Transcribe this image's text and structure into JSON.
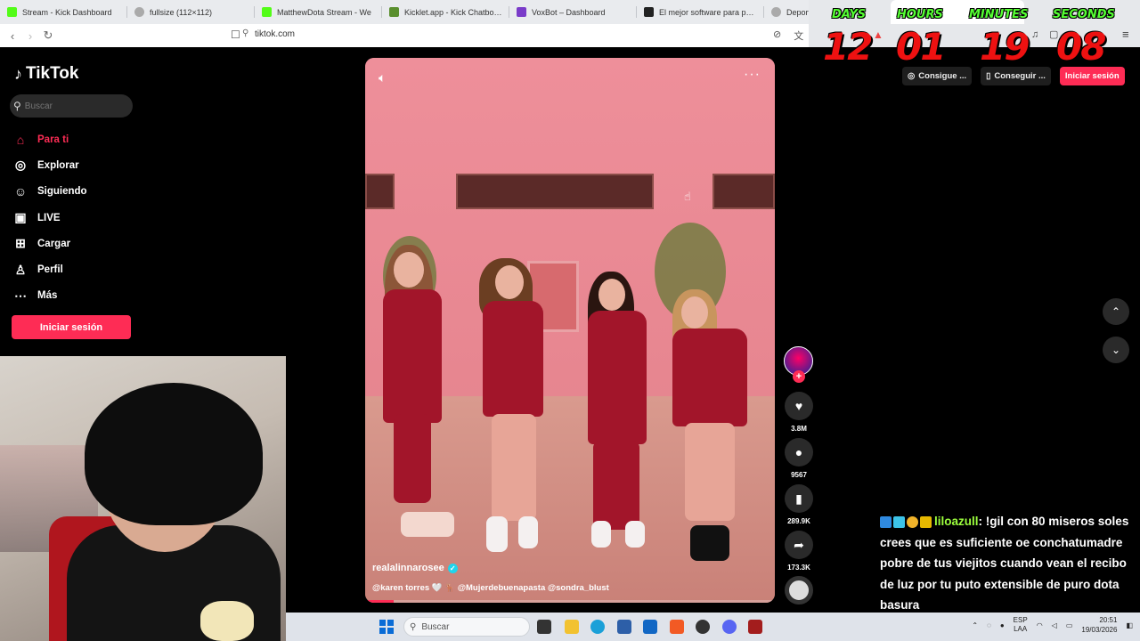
{
  "browser": {
    "tabs": [
      {
        "label": "Stream - Kick Dashboard",
        "color": "#53fc18"
      },
      {
        "label": "fullsize (112×112)",
        "color": "#888888"
      },
      {
        "label": "MatthewDota Stream - We",
        "color": "#53fc18"
      },
      {
        "label": "Kicklet.app - Kick Chatbot and",
        "color": "#5a8f2e"
      },
      {
        "label": "VoxBot – Dashboard",
        "color": "#7a3cc9"
      },
      {
        "label": "El mejor software para potenci",
        "color": "#222222"
      },
      {
        "label": "Deportes sin di",
        "color": "#888888"
      }
    ],
    "url": "tiktok.com"
  },
  "overlay": {
    "labels": [
      "DAYS",
      "HOURS",
      "MINUTES",
      "SECONDS"
    ],
    "values": [
      "12",
      "01",
      "19",
      "08"
    ]
  },
  "sidebar": {
    "brand": "TikTok",
    "search_placeholder": "Buscar",
    "items": [
      {
        "label": "Para ti",
        "icon": "home-icon"
      },
      {
        "label": "Explorar",
        "icon": "compass-icon"
      },
      {
        "label": "Siguiendo",
        "icon": "following-icon"
      },
      {
        "label": "LIVE",
        "icon": "live-icon"
      },
      {
        "label": "Cargar",
        "icon": "upload-icon"
      },
      {
        "label": "Perfil",
        "icon": "profile-icon"
      },
      {
        "label": "Más",
        "icon": "more-icon"
      }
    ],
    "login_label": "Iniciar sesión",
    "active_color": "#fe2c55"
  },
  "video": {
    "author": "realalinnarosee",
    "caption": "@karen torres 🤍 🦌 @Mujerdebuenapasta @sondra_blust",
    "progress": 0.07
  },
  "actions": {
    "likes": "3.8M",
    "comments": "9567",
    "saves": "289.9K",
    "shares": "173.3K"
  },
  "top_right": {
    "coins_label": "Consigue ...",
    "app_label": "Conseguir ...",
    "login_label": "Iniciar sesión"
  },
  "chat": {
    "username": "liloazull",
    "message": ": !gil con 80 miseros soles crees que es suficiente oe conchatumadre pobre de tus viejitos cuando vean el recibo de luz por tu puto extensible de puro dota basura"
  },
  "taskbar": {
    "search_placeholder": "Buscar",
    "lang_top": "ESP",
    "lang_bottom": "LAA",
    "time": "20:51",
    "date": "19/03/2026"
  }
}
